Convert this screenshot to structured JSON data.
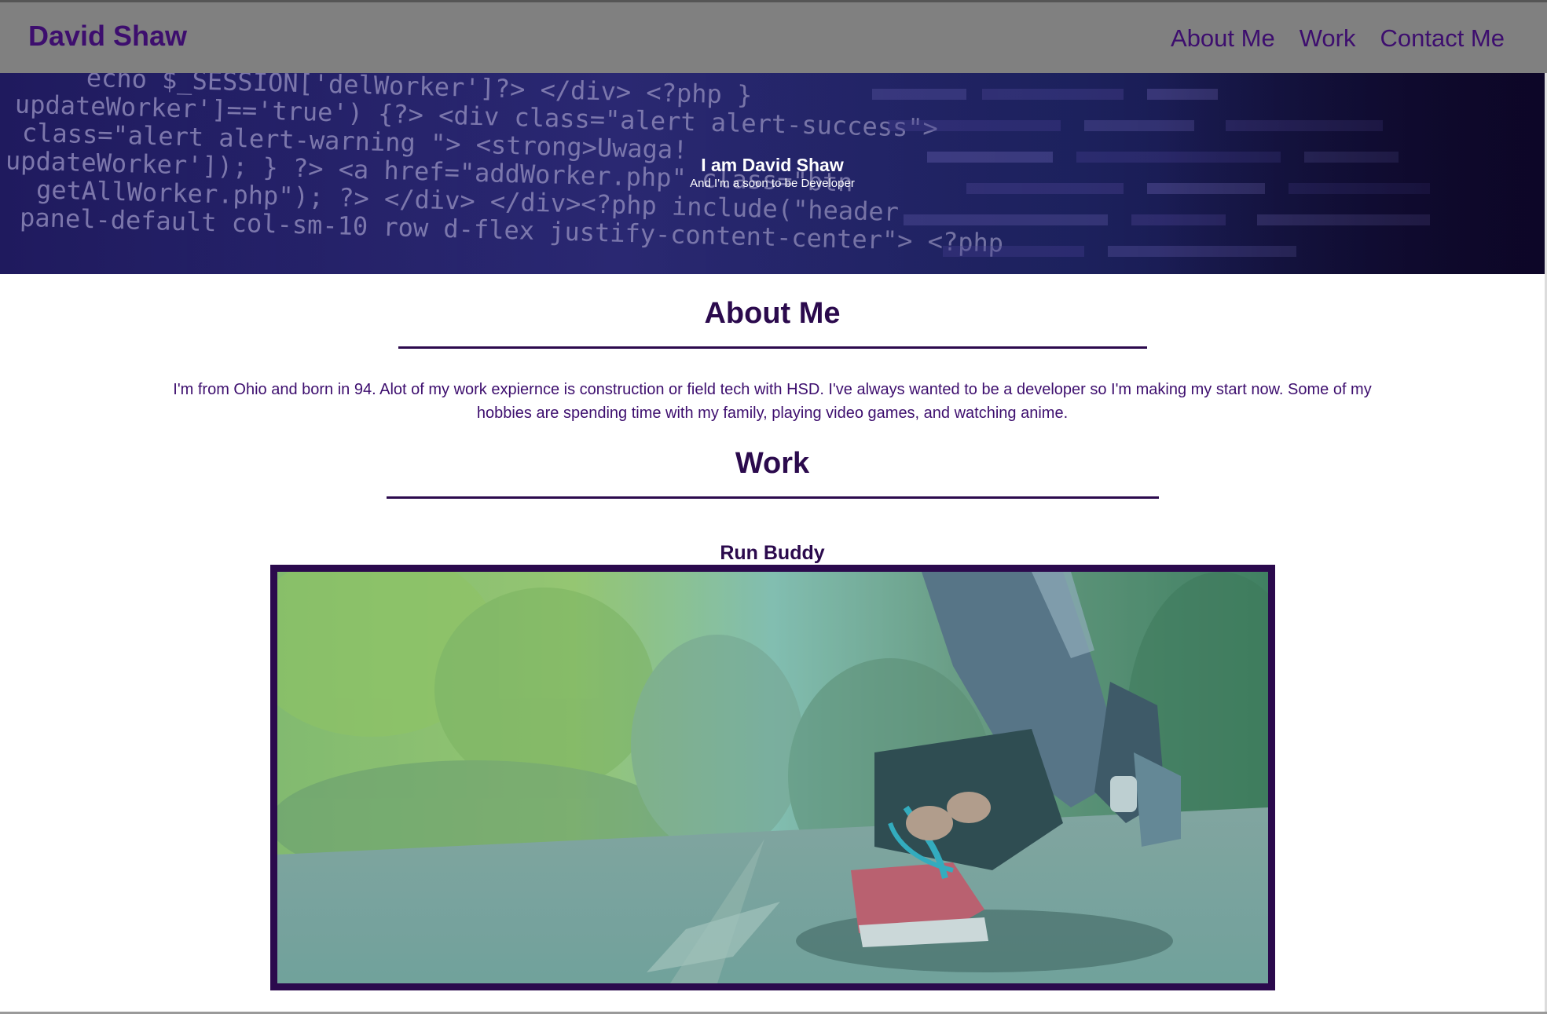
{
  "header": {
    "brand": "David Shaw",
    "nav": [
      "About Me",
      "Work",
      "Contact Me"
    ]
  },
  "hero": {
    "title": "I am David Shaw",
    "subtitle": "And I'm a soon to be Developer",
    "code_lines": [
      "echo $_SESSION['delWorker']?> </div> <?php }",
      "updateWorker']=='true') {?> <div class=\"alert alert-success\">",
      "class=\"alert alert-warning \"> <strong>Uwaga!",
      "updateWorker']); } ?> <a href=\"addWorker.php\" class=\"btn",
      "getAllWorker.php\"); ?> </div> </div><?php   include(\"header",
      "panel-default col-sm-10 row d-flex justify-content-center\"> <?php"
    ]
  },
  "about": {
    "heading": "About Me",
    "text": "I'm from Ohio and born in 94. Alot of my work expiernce is construction or field tech with HSD. I've always wanted to be a developer so I'm making my start now. Some of my hobbies are spending time with my family, playing video games, and watching anime."
  },
  "work": {
    "heading": "Work",
    "projects": [
      {
        "title": "Run Buddy",
        "image": "runner-tying-shoe-photo"
      }
    ]
  },
  "colors": {
    "primary": "#2b0a4d",
    "nav_text": "#3d0e6e",
    "header_bg": "#808080"
  }
}
